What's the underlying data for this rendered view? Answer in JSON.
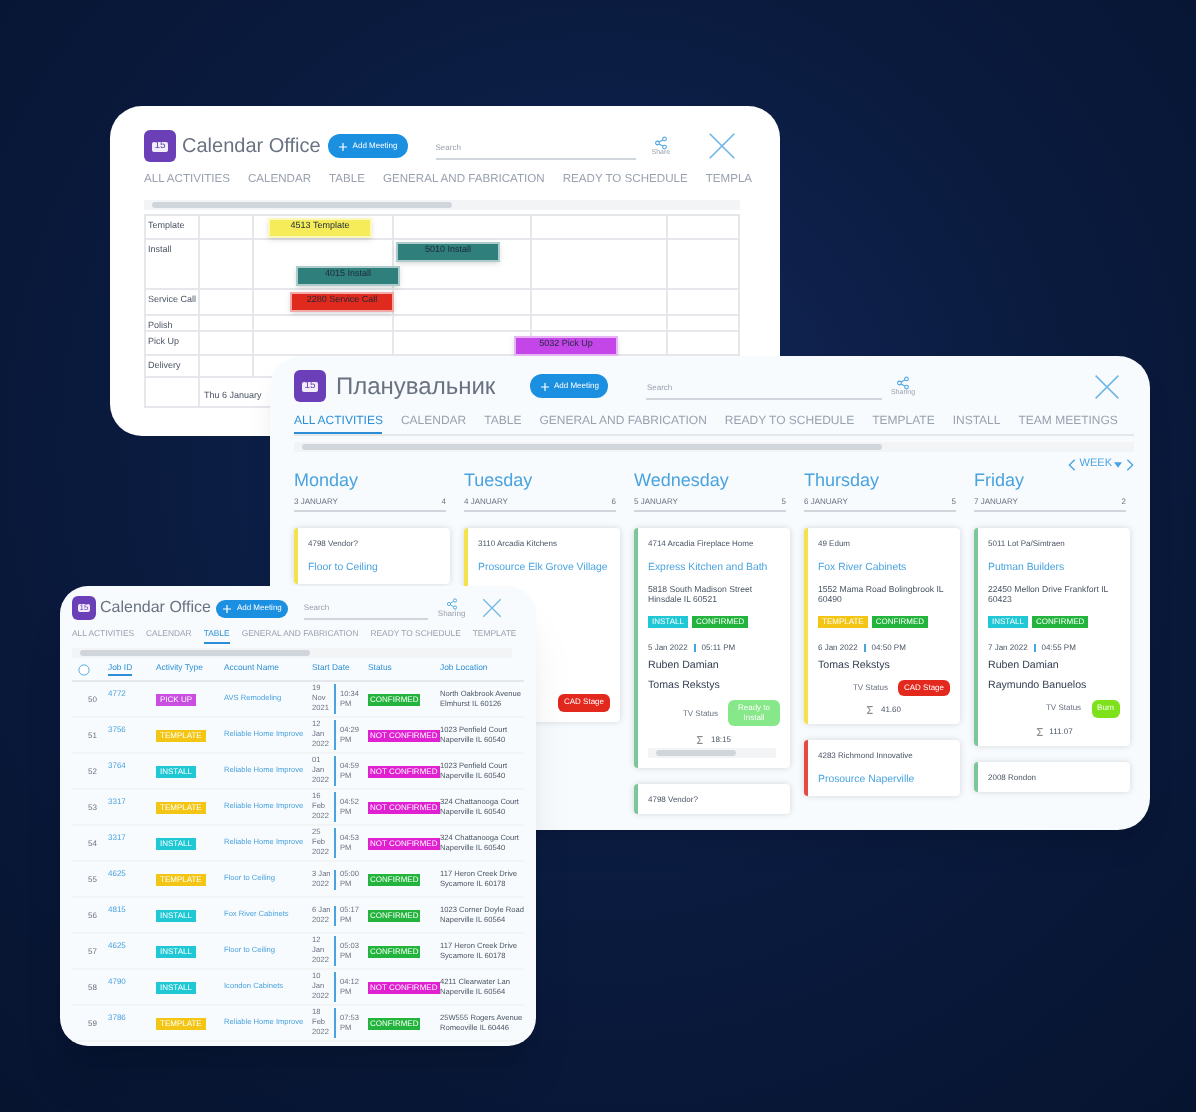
{
  "back_window": {
    "icon_text": "15",
    "title": "Calendar Office",
    "add_button": "Add Meeting",
    "search_label": "Search",
    "share_label": "Share",
    "tabs": [
      {
        "label": "ALL ACTIVITIES",
        "selected": false
      },
      {
        "label": "CALENDAR",
        "selected": false
      },
      {
        "label": "TABLE",
        "selected": false
      },
      {
        "label": "GENERAL AND FABRICATION",
        "selected": false
      },
      {
        "label": "READY TO SCHEDULE",
        "selected": false
      },
      {
        "label": "TEMPLA",
        "selected": false
      }
    ],
    "rows": [
      {
        "label": "Template",
        "events": [
          {
            "label": "4513 Template",
            "color": "#f6ec5a"
          }
        ]
      },
      {
        "label": "Install",
        "events": [
          {
            "label": "5010 Install",
            "color": "#2f7f7c"
          },
          {
            "label": "4015 Install",
            "color": "#2f7f7c"
          }
        ]
      },
      {
        "label": "Service Call",
        "events": [
          {
            "label": "2280 Service Call",
            "color": "#e02a1e"
          }
        ]
      },
      {
        "label": "Polish",
        "events": []
      },
      {
        "label": "Pick Up",
        "events": [
          {
            "label": "5032 Pick Up",
            "color": "#c445e8"
          }
        ]
      },
      {
        "label": "Delivery",
        "events": []
      }
    ],
    "footer_date": "Thu 6 January"
  },
  "planner_window": {
    "icon_text": "15",
    "title": "Планувальник",
    "add_button": "Add Meeting",
    "search_label": "Search",
    "share_label": "Sharing",
    "tabs": [
      {
        "label": "ALL ACTIVITIES",
        "selected": true
      },
      {
        "label": "CALENDAR",
        "selected": false
      },
      {
        "label": "TABLE",
        "selected": false
      },
      {
        "label": "GENERAL AND FABRICATION",
        "selected": false
      },
      {
        "label": "READY TO SCHEDULE",
        "selected": false
      },
      {
        "label": "TEMPLATE",
        "selected": false
      },
      {
        "label": "INSTALL",
        "selected": false
      },
      {
        "label": "TEAM MEETINGS",
        "selected": false
      }
    ],
    "view": "WEEK",
    "days": [
      {
        "name": "Monday",
        "date": "3 JANUARY",
        "count": "4",
        "cards": [
          {
            "color": "#f3e24c",
            "ref": "4798 Vendor?",
            "title": "Floor to Ceiling"
          }
        ]
      },
      {
        "name": "Tuesday",
        "date": "4 JANUARY",
        "count": "6",
        "cards": [
          {
            "color": "#f3e24c",
            "ref": "3110 Arcadia Kitchens",
            "title": "Prosource Elk Grove Village",
            "tv_badge": {
              "label": "CAD Stage",
              "color": "#e3281e"
            }
          }
        ]
      },
      {
        "name": "Wednesday",
        "date": "5 JANUARY",
        "count": "5",
        "cards": [
          {
            "color": "#7cc79a",
            "ref": "4714 Arcadia Fireplace Home",
            "title": "Express Kitchen and Bath",
            "address": "5818 South Madison Street Hinsdale IL 60521",
            "badges": [
              {
                "label": "INSTALL",
                "color": "#1fc8d4"
              },
              {
                "label": "CONFIRMED",
                "color": "#22b43c"
              }
            ],
            "date": "5 Jan 2022",
            "time": "05:11 PM",
            "people": [
              "Ruben Damian",
              "Tomas Rekstys"
            ],
            "tv_label": "TV Status",
            "tv_badge": {
              "label": "Ready to Install",
              "color": "#86e888"
            },
            "total": "18:15",
            "scrollable": true
          },
          {
            "color": "#7cc79a",
            "ref": "4798 Vendor?"
          }
        ]
      },
      {
        "name": "Thursday",
        "date": "6 JANUARY",
        "count": "5",
        "cards": [
          {
            "color": "#f3e24c",
            "ref": "49 Edum",
            "title": "Fox River Cabinets",
            "address": "1552 Mama Road Bolingbrook IL 60490",
            "badges": [
              {
                "label": "TEMPLATE",
                "color": "#f3c514"
              },
              {
                "label": "CONFIRMED",
                "color": "#22b43c"
              }
            ],
            "date": "6 Jan 2022",
            "time": "04:50 PM",
            "people": [
              "Tomas Rekstys"
            ],
            "tv_label": "TV Status",
            "tv_badge": {
              "label": "CAD Stage",
              "color": "#e3281e"
            },
            "total": "41.60"
          },
          {
            "color": "#e5493f",
            "ref": "4283 Richmond Innovative",
            "title": "Prosource Naperville"
          }
        ]
      },
      {
        "name": "Friday",
        "date": "7 JANUARY",
        "count": "2",
        "cards": [
          {
            "color": "#7cc79a",
            "ref": "5011 Lot Pa/Simtraen",
            "title": "Putman Builders",
            "address": "22450 Mellon Drive Frankfort IL 60423",
            "badges": [
              {
                "label": "INSTALL",
                "color": "#1fc8d4"
              },
              {
                "label": "CONFIRMED",
                "color": "#22b43c"
              }
            ],
            "date": "7 Jan 2022",
            "time": "04:55 PM",
            "people": [
              "Ruben Damian",
              "Raymundo Banuelos"
            ],
            "tv_label": "TV Status",
            "tv_badge": {
              "label": "Burn",
              "color": "#7ee21a"
            },
            "total": "111.07"
          },
          {
            "color": "#7cc79a",
            "ref": "2008 Rondon"
          }
        ]
      }
    ]
  },
  "table_window": {
    "icon_text": "15",
    "title": "Calendar Office",
    "add_button": "Add Meeting",
    "search_label": "Search",
    "share_label": "Sharing",
    "tabs": [
      {
        "label": "ALL ACTIVITIES",
        "selected": false
      },
      {
        "label": "CALENDAR",
        "selected": false
      },
      {
        "label": "TABLE",
        "selected": true
      },
      {
        "label": "GENERAL AND FABRICATION",
        "selected": false
      },
      {
        "label": "READY TO SCHEDULE",
        "selected": false
      },
      {
        "label": "TEMPLATE",
        "selected": false
      }
    ],
    "select_all": {
      "checked": false
    },
    "columns": [
      {
        "label": "Job ID",
        "selected": true
      },
      {
        "label": "Activity Type",
        "selected": false
      },
      {
        "label": "Account Name",
        "selected": false
      },
      {
        "label": "Start Date",
        "selected": false
      },
      {
        "label": "Status",
        "selected": false
      },
      {
        "label": "Job Location",
        "selected": false
      }
    ],
    "rows": [
      {
        "number": "50",
        "job_id": "4772",
        "type": {
          "label": "PICK UP",
          "color": "#c84fe0"
        },
        "account": "AVS Remodeling",
        "date": "19 Nov 2021",
        "time": "10:34 PM",
        "status": {
          "label": "CONFIRMED",
          "color": "#22b43c"
        },
        "location": "North Oakbrook Avenue Elmhurst IL 60126"
      },
      {
        "number": "51",
        "job_id": "3756",
        "type": {
          "label": "TEMPLATE",
          "color": "#f3c514"
        },
        "account": "Reliable Home Improve",
        "date": "12 Jan 2022",
        "time": "04:29 PM",
        "status": {
          "label": "NOT CONFIRMED",
          "color": "#e021d2"
        },
        "location": "1023 Penfield Court Naperville IL 60540"
      },
      {
        "number": "52",
        "job_id": "3764",
        "type": {
          "label": "INSTALL",
          "color": "#1fc8d4"
        },
        "account": "Reliable Home Improve",
        "date": "01 Jan 2022",
        "time": "04:59 PM",
        "status": {
          "label": "NOT CONFIRMED",
          "color": "#e021d2"
        },
        "location": "1023 Penfield Court Naperville IL 60540"
      },
      {
        "number": "53",
        "job_id": "3317",
        "type": {
          "label": "TEMPLATE",
          "color": "#f3c514"
        },
        "account": "Reliable Home Improve",
        "date": "16 Feb 2022",
        "time": "04:52 PM",
        "status": {
          "label": "NOT CONFIRMED",
          "color": "#e021d2"
        },
        "location": "324 Chattanooga Court Naperville IL 60540"
      },
      {
        "number": "54",
        "job_id": "3317",
        "type": {
          "label": "INSTALL",
          "color": "#1fc8d4"
        },
        "account": "Reliable Home Improve",
        "date": "25 Feb 2022",
        "time": "04:53 PM",
        "status": {
          "label": "NOT CONFIRMED",
          "color": "#e021d2"
        },
        "location": "324 Chattanooga Court Naperville IL 60540"
      },
      {
        "number": "55",
        "job_id": "4625",
        "type": {
          "label": "TEMPLATE",
          "color": "#f3c514"
        },
        "account": "Floor to Ceiling",
        "date": "3 Jan 2022",
        "time": "05:00 PM",
        "status": {
          "label": "CONFIRMED",
          "color": "#22b43c"
        },
        "location": "117 Heron Creek Drive Sycamore IL 60178"
      },
      {
        "number": "56",
        "job_id": "4815",
        "type": {
          "label": "INSTALL",
          "color": "#1fc8d4"
        },
        "account": "Fox River Cabinets",
        "date": "6 Jan 2022",
        "time": "05:17 PM",
        "status": {
          "label": "CONFIRMED",
          "color": "#22b43c"
        },
        "location": "1023 Corner Doyle Road Naperville IL 60564"
      },
      {
        "number": "57",
        "job_id": "4625",
        "type": {
          "label": "INSTALL",
          "color": "#1fc8d4"
        },
        "account": "Floor to Ceiling",
        "date": "12 Jan 2022",
        "time": "05:03 PM",
        "status": {
          "label": "CONFIRMED",
          "color": "#22b43c"
        },
        "location": "117 Heron Creek Drive Sycamore IL 60178"
      },
      {
        "number": "58",
        "job_id": "4790",
        "type": {
          "label": "INSTALL",
          "color": "#1fc8d4"
        },
        "account": "Icondon Cabinets",
        "date": "10 Jan 2022",
        "time": "04:12 PM",
        "status": {
          "label": "NOT CONFIRMED",
          "color": "#e021d2"
        },
        "location": "4211 Clearwater Lan Naperville IL 60564"
      },
      {
        "number": "59",
        "job_id": "3786",
        "type": {
          "label": "TEMPLATE",
          "color": "#f3c514"
        },
        "account": "Reliable Home Improve",
        "date": "18 Feb 2022",
        "time": "07:53 PM",
        "status": {
          "label": "CONFIRMED",
          "color": "#22b43c"
        },
        "location": "25W555 Rogers Avenue Romeoville IL 60446"
      }
    ]
  }
}
